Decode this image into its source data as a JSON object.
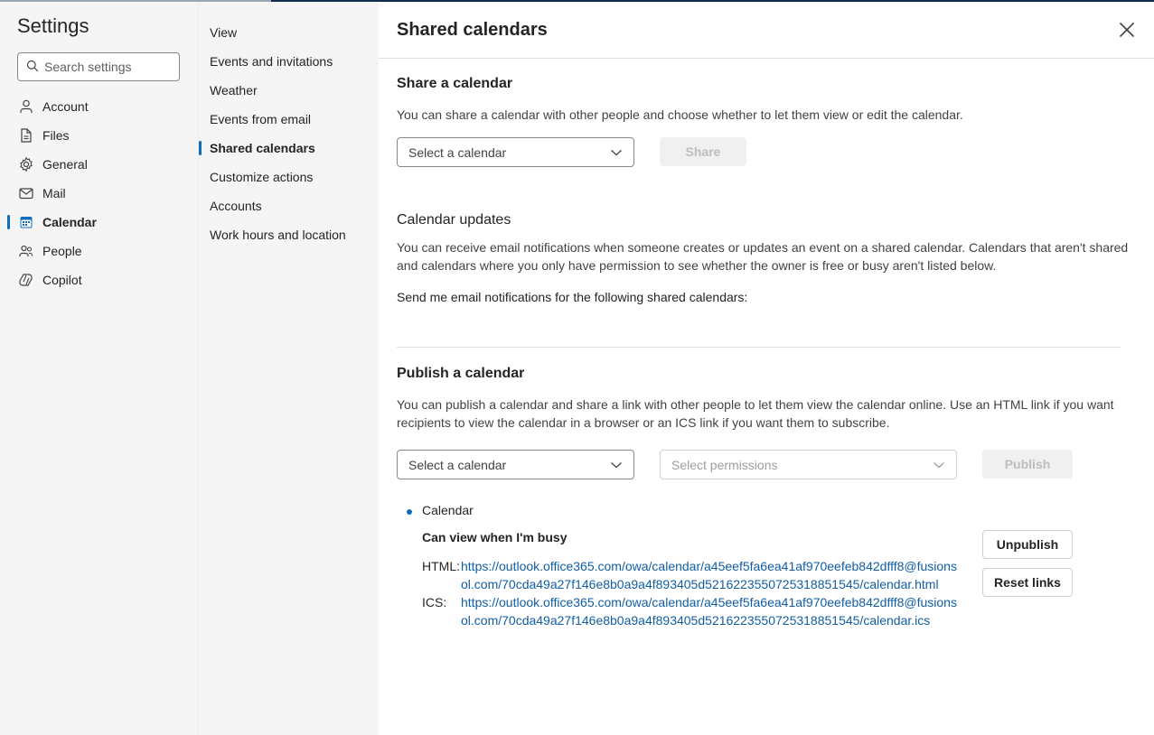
{
  "nav": {
    "title": "Settings",
    "search_placeholder": "Search settings",
    "items": [
      {
        "label": "Account",
        "icon": "person-icon"
      },
      {
        "label": "Files",
        "icon": "file-icon"
      },
      {
        "label": "General",
        "icon": "gear-icon"
      },
      {
        "label": "Mail",
        "icon": "mail-icon"
      },
      {
        "label": "Calendar",
        "icon": "calendar-icon",
        "active": true
      },
      {
        "label": "People",
        "icon": "people-icon"
      },
      {
        "label": "Copilot",
        "icon": "copilot-icon"
      }
    ]
  },
  "subnav": {
    "items": [
      {
        "label": "View"
      },
      {
        "label": "Events and invitations"
      },
      {
        "label": "Weather"
      },
      {
        "label": "Events from email"
      },
      {
        "label": "Shared calendars",
        "active": true
      },
      {
        "label": "Customize actions"
      },
      {
        "label": "Accounts"
      },
      {
        "label": "Work hours and location"
      }
    ]
  },
  "content": {
    "title": "Shared calendars",
    "share": {
      "title": "Share a calendar",
      "desc": "You can share a calendar with other people and choose whether to let them view or edit the calendar.",
      "select_label": "Select a calendar",
      "share_button": "Share"
    },
    "updates": {
      "title": "Calendar updates",
      "desc": "You can receive email notifications when someone creates or updates an event on a shared calendar. Calendars that aren't shared and calendars where you only have permission to see whether the owner is free or busy aren't listed below.",
      "notify_label": "Send me email notifications for the following shared calendars:"
    },
    "publish": {
      "title": "Publish a calendar",
      "desc": "You can publish a calendar and share a link with other people to let them view the calendar online. Use an HTML link if you want recipients to view the calendar in a browser or an ICS link if you want them to subscribe.",
      "select_label": "Select a calendar",
      "permissions_label": "Select permissions",
      "publish_button": "Publish",
      "published": {
        "calendar_name": "Calendar",
        "permission": "Can view when I'm busy",
        "html_label": "HTML:",
        "html_url": "https://outlook.office365.com/owa/calendar/a45eef5fa6ea41af970eefeb842dfff8@fusionsol.com/70cda49a27f146e8b0a9a4f893405d5216223550725318851545/calendar.html",
        "ics_label": "ICS:",
        "ics_url": "https://outlook.office365.com/owa/calendar/a45eef5fa6ea41af970eefeb842dfff8@fusionsol.com/70cda49a27f146e8b0a9a4f893405d5216223550725318851545/calendar.ics",
        "unpublish_button": "Unpublish",
        "reset_button": "Reset links"
      }
    }
  },
  "colors": {
    "accent": "#0f6cbd",
    "link": "#115ea3",
    "nav_bg": "#f5f5f5"
  }
}
